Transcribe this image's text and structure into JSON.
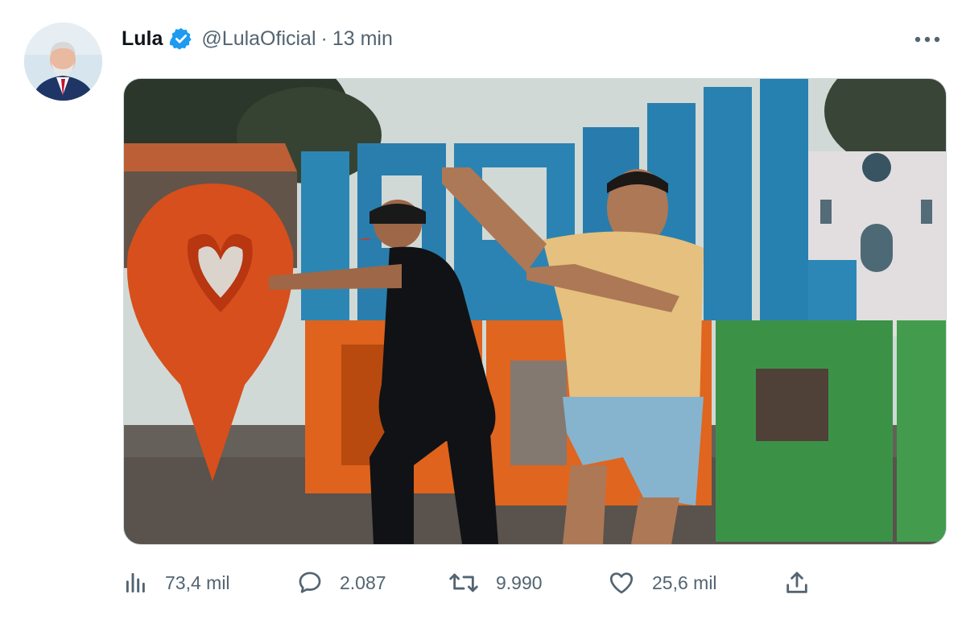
{
  "tweet": {
    "author_name": "Lula",
    "handle": "@LulaOficial",
    "separator": "·",
    "time": "13 min"
  },
  "media": {
    "description_icon": "video-thumbnail"
  },
  "actions": {
    "views": "73,4 mil",
    "replies": "2.087",
    "retweets": "9.990",
    "likes": "25,6 mil"
  },
  "icons": {
    "verified": "verified-badge-icon",
    "more": "more-dots-icon",
    "views": "bar-chart-icon",
    "reply": "comment-icon",
    "retweet": "retweet-icon",
    "like": "heart-icon",
    "share": "share-icon"
  },
  "colors": {
    "verified_blue": "#1d9bf0",
    "secondary_text": "#536471",
    "primary_text": "#0f1419"
  }
}
